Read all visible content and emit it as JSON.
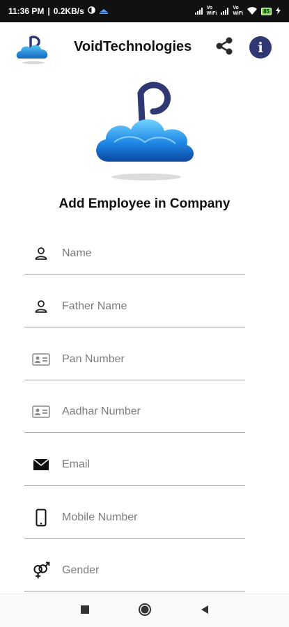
{
  "status_bar": {
    "time": "11:36 PM",
    "speed": "0.2KB/s",
    "net1": "Vo\nWiFi",
    "net2": "Vo\nWiFi",
    "battery": "85"
  },
  "app_bar": {
    "title": "VoidTechnologies"
  },
  "form": {
    "title": "Add Employee in Company",
    "fields": [
      {
        "placeholder": "Name",
        "icon": "person-icon"
      },
      {
        "placeholder": "Father Name",
        "icon": "person-icon"
      },
      {
        "placeholder": "Pan Number",
        "icon": "id-card-icon"
      },
      {
        "placeholder": "Aadhar Number",
        "icon": "id-card-icon"
      },
      {
        "placeholder": "Email",
        "icon": "envelope-icon"
      },
      {
        "placeholder": "Mobile Number",
        "icon": "smartphone-icon"
      },
      {
        "placeholder": "Gender",
        "icon": "gender-icon"
      }
    ]
  },
  "colors": {
    "accent": "#2f3873",
    "cloud": "#1e88e5"
  }
}
